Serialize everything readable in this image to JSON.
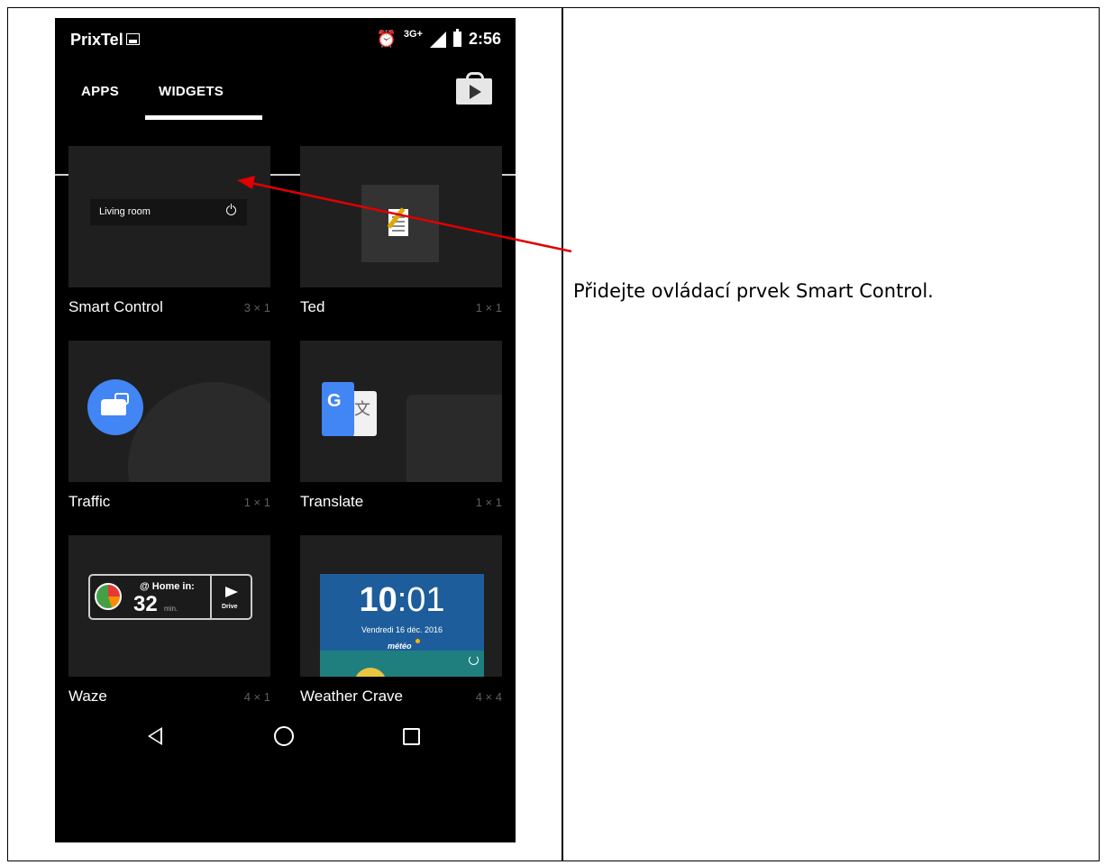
{
  "status_bar": {
    "carrier": "PrixTel",
    "network": "3G+",
    "time": "2:56"
  },
  "tabs": {
    "apps": "APPS",
    "widgets": "WIDGETS"
  },
  "widgets": [
    {
      "name": "Smart Control",
      "size": "3 × 1",
      "preview_text": "Living room"
    },
    {
      "name": "Ted",
      "size": "1 × 1"
    },
    {
      "name": "Traffic",
      "size": "1 × 1"
    },
    {
      "name": "Translate",
      "size": "1 × 1",
      "preview_text": "G"
    },
    {
      "name": "Waze",
      "size": "4 × 1",
      "preview": {
        "home": "@ Home in:",
        "minutes": "32",
        "unit": "min.",
        "drive": "Drive"
      }
    },
    {
      "name": "Weather Crave",
      "size": "4 × 4",
      "preview": {
        "hour": "10",
        "minute": ":01",
        "date": "Vendredi 16 déc. 2016",
        "brand": "météo"
      }
    }
  ],
  "annotation": "Přidejte ovládací prvek Smart Control.",
  "colors": {
    "arrow": "#e00000",
    "traffic_blue": "#4285f4",
    "weather_blue": "#1e5d9b"
  }
}
